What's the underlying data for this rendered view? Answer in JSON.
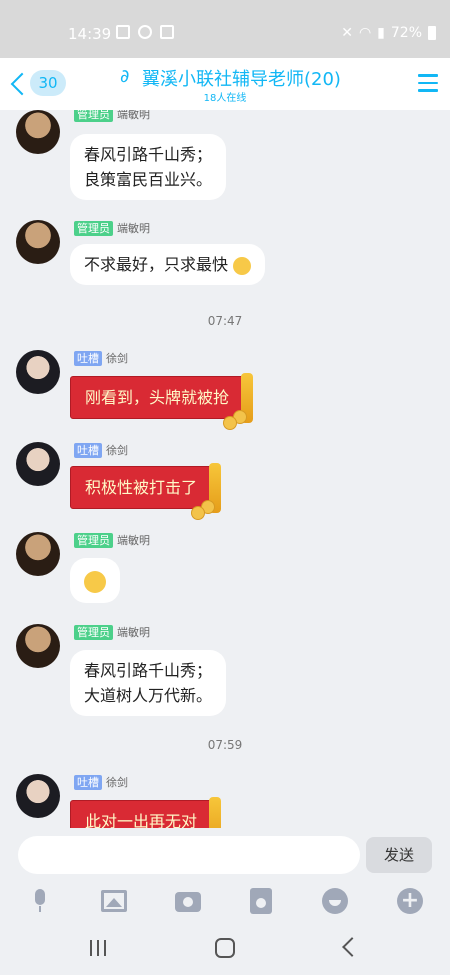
{
  "status": {
    "time": "14:39",
    "battery": "72%"
  },
  "header": {
    "unread": "30",
    "title": "翼溪小联社辅导老师(20)",
    "subtitle": "18人在线"
  },
  "messages": [
    {
      "role": "管理员",
      "sender": "端敏明",
      "text_line1": "春风引路千山秀；",
      "text_line2": "良策富民百业兴。"
    },
    {
      "role": "管理员",
      "sender": "端敏明",
      "text": "不求最好，只求最快"
    },
    {
      "time": "07:47"
    },
    {
      "role": "吐槽",
      "sender": "徐剑",
      "text": "刚看到，头牌就被抢"
    },
    {
      "role": "吐槽",
      "sender": "徐剑",
      "text": "积极性被打击了"
    },
    {
      "role": "管理员",
      "sender": "端敏明"
    },
    {
      "role": "管理员",
      "sender": "端敏明",
      "text_line1": "春风引路千山秀；",
      "text_line2": "大道树人万代新。"
    },
    {
      "time": "07:59"
    },
    {
      "role": "吐槽",
      "sender": "徐剑",
      "text": "此对一出再无对"
    }
  ],
  "input": {
    "send_label": "发送"
  },
  "icons": {
    "toolbar": [
      "mic-icon",
      "image-icon",
      "camera-icon",
      "red-packet-icon",
      "emoji-icon",
      "plus-icon"
    ],
    "nav": [
      "recent-apps-icon",
      "home-icon",
      "back-icon"
    ]
  },
  "colors": {
    "accent": "#12b7f5",
    "admin_badge": "#4cd08a",
    "tucao_badge": "#7fa6f2",
    "red_bubble": "#d92a34"
  }
}
